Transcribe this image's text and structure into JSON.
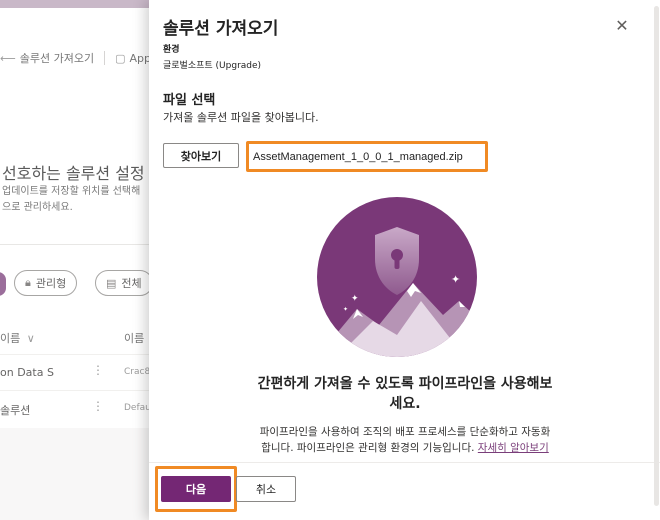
{
  "background": {
    "breadcrumb_back": "솔루션 가져오기",
    "breadcrumb_next": "App",
    "heading": "선호하는 솔루션 설정",
    "desc_line1": "업데이트를 저장할 위치를 선택해",
    "desc_line2": "으로 관리하세요.",
    "chip_managed": "관리형",
    "chip_all": "전체",
    "col_name": "이름",
    "col_name2": "이름",
    "rows": [
      {
        "name": "on Data S",
        "id": "Crac8"
      },
      {
        "name": "솔루션",
        "id": "Defau"
      }
    ]
  },
  "panel": {
    "title": "솔루션 가져오기",
    "close_icon": "close-icon",
    "environment_label": "환경",
    "environment_value": "글로벌소프트 (Upgrade)",
    "section_title": "파일 선택",
    "section_desc": "가져올 솔루션 파일을 찾아봅니다.",
    "browse_label": "찾아보기",
    "file_name": "AssetManagement_1_0_0_1_managed.zip",
    "promo_title_line1": "간편하게 가져올 수 있도록 파이프라인을 사용해보",
    "promo_title_line2": "세요.",
    "promo_desc_line1": "파이프라인을 사용하여 조직의 배포 프로세스를 단순화하고 자동화",
    "promo_desc_line2": "합니다. 파이프라인은 관리형 환경의 기능입니다.",
    "promo_link": "자세히 알아보기",
    "next_label": "다음",
    "cancel_label": "취소"
  },
  "colors": {
    "accent": "#742774",
    "highlight": "#f08a24",
    "link": "#7a3e7a"
  }
}
